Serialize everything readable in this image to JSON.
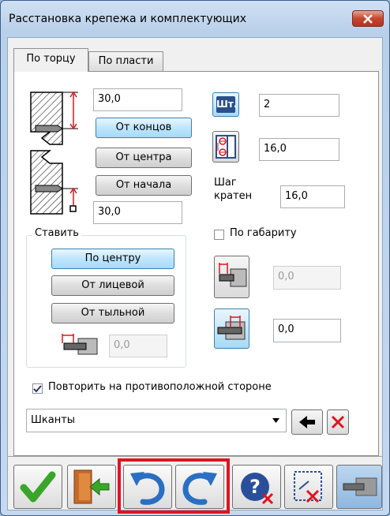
{
  "window": {
    "title": "Расстановка крепежа и комплектующих",
    "close_label": "x"
  },
  "tabs": [
    {
      "label": "По торцу",
      "active": true
    },
    {
      "label": "По пласти",
      "active": false
    }
  ],
  "left": {
    "top_offset": "30,0",
    "buttons": [
      "От концов",
      "От центра",
      "От начала"
    ],
    "active_button": "От концов",
    "bottom_offset": "30,0"
  },
  "right": {
    "count_button": "Шт.",
    "count_value": "2",
    "step_value": "16,0",
    "step_multiple_label_line1": "Шаг",
    "step_multiple_label_line2": "кратен",
    "step_multiple_value": "16,0",
    "by_size_label": "По габариту",
    "by_size_checked": false,
    "offset_a_value": "0,0",
    "offset_b_value": "0,0"
  },
  "place_group": {
    "legend": "Ставить",
    "buttons": [
      "По центру",
      "От лицевой",
      "От тыльной"
    ],
    "active_button": "По центру",
    "offset_value": "0,0"
  },
  "repeat": {
    "label": "Повторить на противоположной стороне",
    "checked": true
  },
  "fastener_select": {
    "value": "Шканты"
  },
  "colors": {
    "accent": "#3c7fb1",
    "highlight": "#e0141e",
    "ok_green": "#3aa52a",
    "cancel_red": "#e0141e"
  }
}
